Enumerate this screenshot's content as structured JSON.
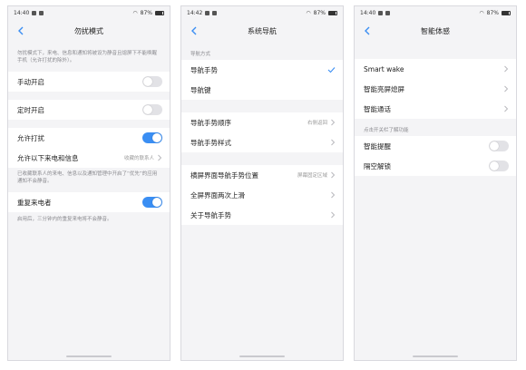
{
  "colors": {
    "accent": "#3a8ef3",
    "bg": "#f4f4f6",
    "toggle_off": "#e2e2e6"
  },
  "screens": [
    {
      "status": {
        "time": "14:40",
        "battery": "87%"
      },
      "title": "勿扰模式",
      "note": "勿扰模式下，来电、信息和通知将被设为静音且熄屏下不能唤醒手机（允许打扰的除外）。",
      "rows": [
        {
          "label": "手动开启",
          "toggle": false
        },
        {
          "label": "定时开启",
          "toggle": false
        },
        {
          "label": "允许打扰",
          "toggle": true
        },
        {
          "label": "允许以下来电和信息",
          "value": "收藏的联系人"
        },
        {
          "label": "重复来电者",
          "toggle": true
        }
      ],
      "note2": "已收藏联系人的来电、信息以及通知管理中开启了“优先”的应用通知不会静音。",
      "note3": "启用后，三分钟内的重复来电将不会静音。"
    },
    {
      "status": {
        "time": "14:42",
        "battery": "87%"
      },
      "title": "系统导航",
      "section": "导航方式",
      "rows": [
        {
          "label": "导航手势",
          "checked": true
        },
        {
          "label": "导航键"
        },
        {
          "label": "导航手势顺序",
          "value": "右侧返回"
        },
        {
          "label": "导航手势样式"
        },
        {
          "label": "横屏界面导航手势位置",
          "value": "屏幕固定区域"
        },
        {
          "label": "全屏界面两次上滑"
        },
        {
          "label": "关于导航手势"
        }
      ]
    },
    {
      "status": {
        "time": "14:40",
        "battery": "87%"
      },
      "title": "智能体感",
      "rows": [
        {
          "label": "Smart wake"
        },
        {
          "label": "智能亮屏熄屏"
        },
        {
          "label": "智能通话"
        },
        {
          "label": "智能提醒",
          "toggle": false
        },
        {
          "label": "隔空解锁",
          "toggle": false
        }
      ],
      "section": "点击开关栏了解功能"
    }
  ]
}
